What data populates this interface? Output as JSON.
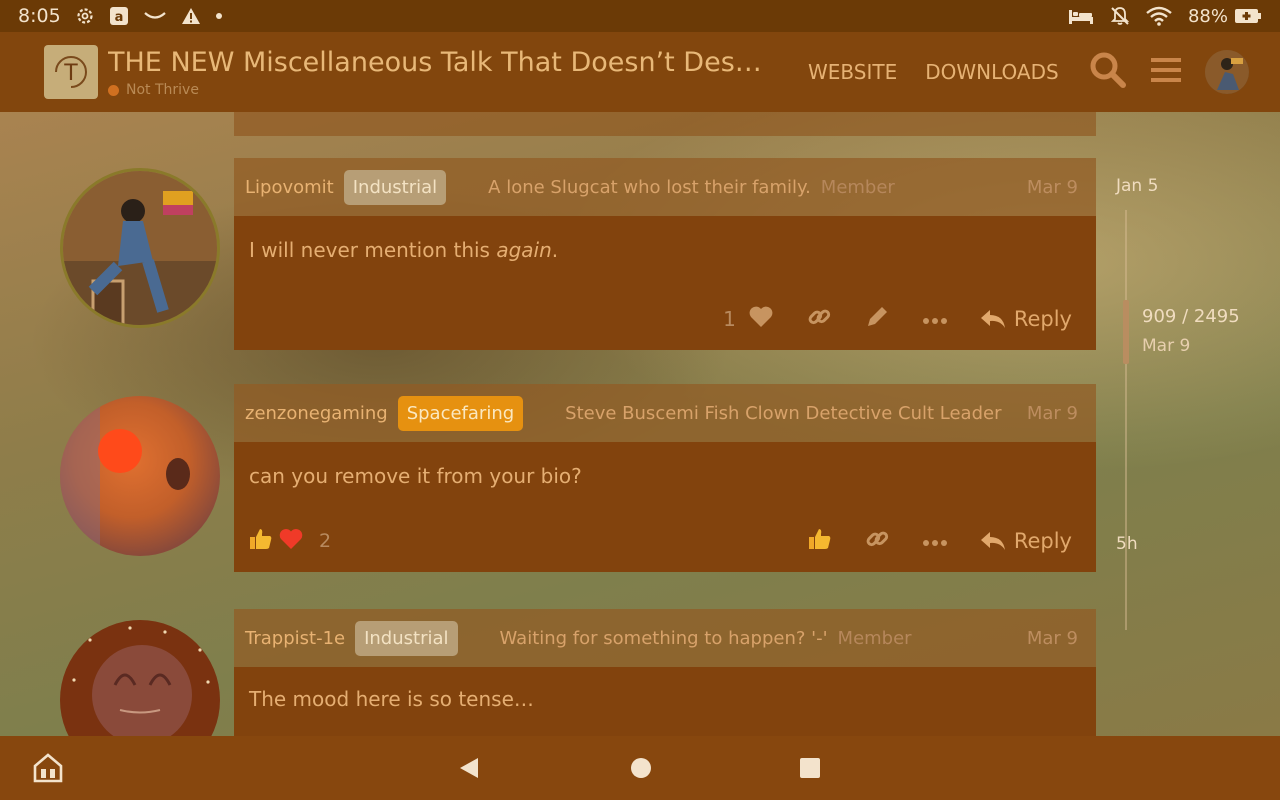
{
  "status_bar": {
    "time": "8:05",
    "battery": "88%",
    "icons_left": [
      "settings-icon",
      "amazon-icon",
      "smile-icon",
      "warning-icon",
      "dot-icon"
    ],
    "icons_right": [
      "bed-icon",
      "bell-off-icon",
      "wifi-icon",
      "battery-icon"
    ]
  },
  "header": {
    "logo_letter": "T",
    "topic_title": "THE NEW Miscellaneous Talk That Doesn’t Deserve Its Own Topic",
    "category": "Not Thrive",
    "category_color": "#d07020",
    "nav": [
      "WEBSITE",
      "DOWNLOADS"
    ]
  },
  "posts": [
    {
      "username": "Lipovomit",
      "badge": "Industrial",
      "user_title": "A lone Slugcat who lost their family.",
      "role": "Member",
      "date": "Mar 9",
      "text_plain": "I will never mention this ",
      "text_em": "again",
      "text_end": ".",
      "like_count": "1",
      "reply_label": "Reply"
    },
    {
      "username": "zenzonegaming",
      "badge": "Spacefaring",
      "user_title": "Steve Buscemi Fish Clown Detective Cult Leader",
      "role": "",
      "date": "Mar 9",
      "text": "can you remove it from your bio?",
      "reaction_count": "2",
      "reply_label": "Reply"
    },
    {
      "username": "Trappist-1e",
      "badge": "Industrial",
      "user_title": "Waiting for something to happen? '-'",
      "role": "Member",
      "date": "Mar 9",
      "text": "The mood here is so tense…"
    }
  ],
  "timeline": {
    "start": "Jan 5",
    "position": "909 / 2495",
    "position_date": "Mar 9",
    "end": "5h"
  },
  "colors": {
    "accent": "#e69110",
    "header_bg": "#82460d",
    "post_body_bg": "#82430d"
  }
}
